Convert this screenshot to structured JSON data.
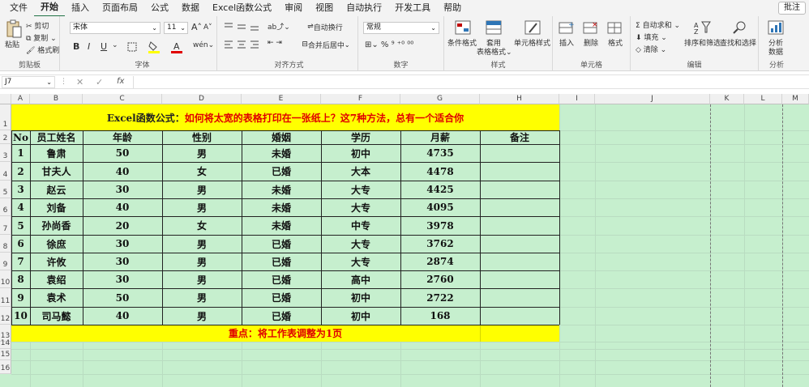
{
  "menu": {
    "items": [
      "文件",
      "开始",
      "插入",
      "页面布局",
      "公式",
      "数据",
      "Excel函数公式",
      "审阅",
      "视图",
      "自动执行",
      "开发工具",
      "帮助"
    ],
    "active": "开始",
    "comment": "批注"
  },
  "ribbon": {
    "clipboard": {
      "paste": "粘贴",
      "cut": "剪切",
      "copy": "复制",
      "format_painter": "格式刷",
      "label": "剪贴板"
    },
    "font": {
      "name": "宋体",
      "size": "11",
      "label": "字体",
      "bold": "B",
      "italic": "I",
      "underline": "U",
      "grow": "A",
      "shrink": "A"
    },
    "align": {
      "wrap": "自动换行",
      "merge": "合并后居中",
      "label": "对齐方式"
    },
    "number": {
      "format": "常规",
      "label": "数字"
    },
    "styles": {
      "cond": "条件格式",
      "table": "套用",
      "table2": "表格格式",
      "cellstyle": "单元格样式",
      "label": "样式"
    },
    "cells": {
      "insert": "插入",
      "delete": "删除",
      "format": "格式",
      "label": "单元格"
    },
    "editing": {
      "autosum": "自动求和",
      "fill": "填充",
      "clear": "清除",
      "sort": "排序和筛选",
      "find": "查找和选择",
      "label": "编辑"
    },
    "analysis": {
      "btn": "分析",
      "btn2": "数据",
      "label": "分析"
    }
  },
  "formula_bar": {
    "name_box": "J7",
    "fx": "fx",
    "value": ""
  },
  "columns": [
    "A",
    "B",
    "C",
    "D",
    "E",
    "F",
    "G",
    "H",
    "I",
    "J",
    "K",
    "L",
    "M"
  ],
  "rows": [
    "1",
    "2",
    "3",
    "4",
    "5",
    "6",
    "7",
    "8",
    "9",
    "10",
    "11",
    "12",
    "13",
    "14",
    "15",
    "16"
  ],
  "sheet": {
    "title_prefix": "Excel函数公式：",
    "title_rest": "如何将太宽的表格打印在一张纸上？这7种方法，总有一个适合你",
    "headers": [
      "No",
      "员工姓名",
      "年龄",
      "性别",
      "婚姻",
      "学历",
      "月薪",
      "备注"
    ],
    "data": [
      [
        "1",
        "鲁肃",
        "50",
        "男",
        "未婚",
        "初中",
        "4735",
        ""
      ],
      [
        "2",
        "甘夫人",
        "40",
        "女",
        "已婚",
        "大本",
        "4478",
        ""
      ],
      [
        "3",
        "赵云",
        "30",
        "男",
        "未婚",
        "大专",
        "4425",
        ""
      ],
      [
        "4",
        "刘备",
        "40",
        "男",
        "未婚",
        "大专",
        "4095",
        ""
      ],
      [
        "5",
        "孙尚香",
        "20",
        "女",
        "未婚",
        "中专",
        "3978",
        ""
      ],
      [
        "6",
        "徐庶",
        "30",
        "男",
        "已婚",
        "大专",
        "3762",
        ""
      ],
      [
        "7",
        "许攸",
        "30",
        "男",
        "已婚",
        "大专",
        "2874",
        ""
      ],
      [
        "8",
        "袁绍",
        "30",
        "男",
        "已婚",
        "高中",
        "2760",
        ""
      ],
      [
        "9",
        "袁术",
        "50",
        "男",
        "已婚",
        "初中",
        "2722",
        ""
      ],
      [
        "10",
        "司马懿",
        "40",
        "男",
        "已婚",
        "初中",
        "168",
        ""
      ]
    ],
    "footer": "重点：将工作表调整为1页"
  },
  "colors": {
    "accent": "#217346",
    "sheet_bg": "#c6efce",
    "highlight": "#ffff00",
    "title_red": "#e00000"
  }
}
